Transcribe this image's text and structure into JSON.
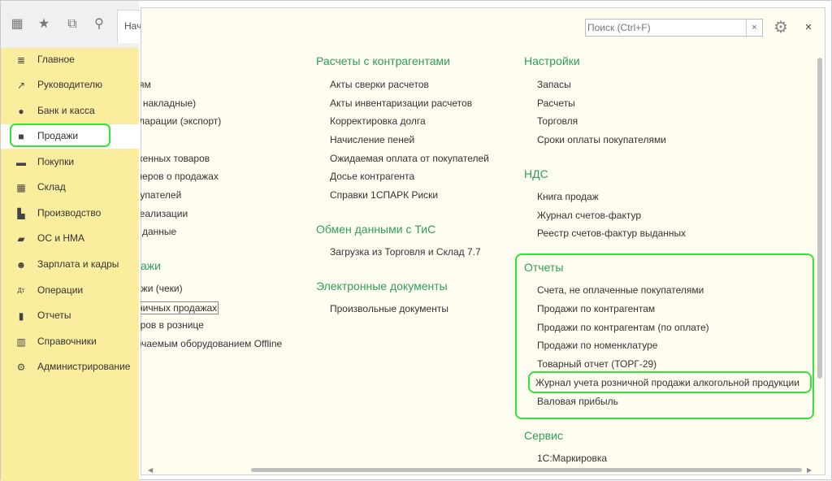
{
  "toolbar": {
    "start_tab_label": "Начальная страница",
    "icons": [
      "apps-grid-icon",
      "star-icon",
      "history-icon",
      "search-icon"
    ]
  },
  "sidebar": {
    "items": [
      {
        "label": "Главное",
        "icon": "menu-icon"
      },
      {
        "label": "Руководителю",
        "icon": "trend-icon"
      },
      {
        "label": "Банк и касса",
        "icon": "coin-icon"
      },
      {
        "label": "Продажи",
        "icon": "shopping-bag-icon",
        "active": true
      },
      {
        "label": "Покупки",
        "icon": "cart-icon"
      },
      {
        "label": "Склад",
        "icon": "warehouse-icon"
      },
      {
        "label": "Производство",
        "icon": "factory-icon"
      },
      {
        "label": "ОС и НМА",
        "icon": "truck-icon"
      },
      {
        "label": "Зарплата и кадры",
        "icon": "person-icon"
      },
      {
        "label": "Операции",
        "icon": "debit-credit-icon"
      },
      {
        "label": "Отчеты",
        "icon": "bar-chart-icon"
      },
      {
        "label": "Справочники",
        "icon": "books-icon"
      },
      {
        "label": "Администрирование",
        "icon": "gear-icon"
      }
    ]
  },
  "search": {
    "placeholder": "Поиск (Ctrl+F)",
    "clear": "×"
  },
  "panel": {
    "close": "×"
  },
  "col1": {
    "links": [
      "ям",
      "т, накладные)",
      "екларации (экспорт)",
      "оженных товаров",
      "тнеров о продажах",
      "купателей",
      "реализации",
      "данные"
    ],
    "section": "ажи",
    "links2": [
      "ажи (чеки)",
      "озничных продажах",
      "оваров в рознице",
      "ключаемым оборудованием Offline"
    ]
  },
  "col2": {
    "sections": [
      {
        "title": "Расчеты с контрагентами",
        "links": [
          "Акты сверки расчетов",
          "Акты инвентаризации расчетов",
          "Корректировка долга",
          "Начисление пеней",
          "Ожидаемая оплата от покупателей",
          "Досье контрагента",
          "Справки 1СПАРК Риски"
        ]
      },
      {
        "title": "Обмен данными с ТиС",
        "links": [
          "Загрузка из Торговля и Склад 7.7"
        ]
      },
      {
        "title": "Электронные документы",
        "links": [
          "Произвольные документы"
        ]
      }
    ]
  },
  "col3": {
    "sections": [
      {
        "title": "Настройки",
        "links": [
          "Запасы",
          "Расчеты",
          "Торговля",
          "Сроки оплаты покупателями"
        ]
      },
      {
        "title": "НДС",
        "links": [
          "Книга продаж",
          "Журнал счетов-фактур",
          "Реестр счетов-фактур выданных"
        ]
      },
      {
        "title": "Отчеты",
        "links": [
          "Счета, не оплаченные покупателями",
          "Продажи по контрагентам",
          "Продажи по контрагентам (по оплате)",
          "Продажи по номенклатуре",
          "Товарный отчет (ТОРГ-29)",
          "Журнал учета розничной продажи алкогольной продукции",
          "Валовая прибыль"
        ]
      },
      {
        "title": "Сервис",
        "links": [
          "1С:Маркировка"
        ]
      }
    ]
  },
  "colors": {
    "sidebar": "#fbed9e",
    "section": "#2f9e58",
    "highlight": "#38e038",
    "panel": "#fffdf0"
  }
}
